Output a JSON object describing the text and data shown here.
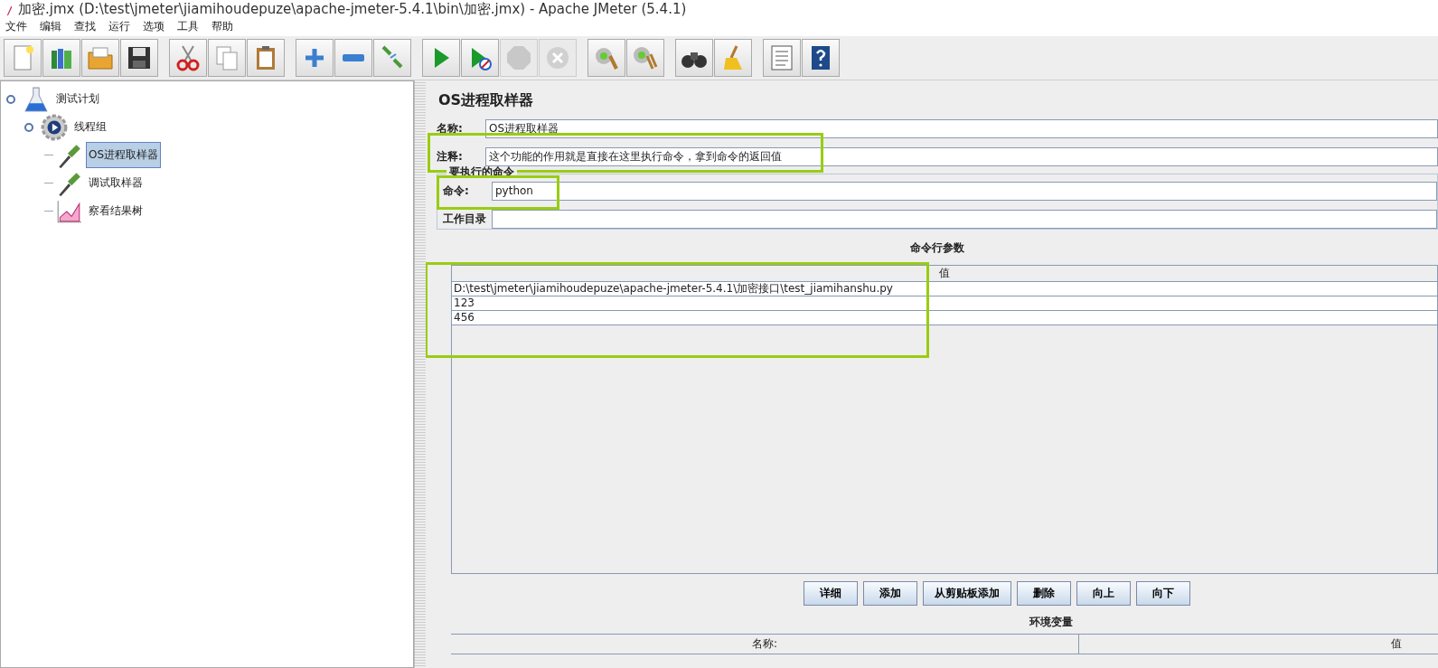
{
  "window": {
    "title": "加密.jmx (D:\\test\\jmeter\\jiamihoudepuze\\apache-jmeter-5.4.1\\bin\\加密.jmx) - Apache JMeter (5.4.1)"
  },
  "menu": [
    "文件",
    "编辑",
    "查找",
    "运行",
    "选项",
    "工具",
    "帮助"
  ],
  "toolbar": [
    [
      {
        "kind": "new",
        "disabled": false
      },
      {
        "kind": "templates",
        "disabled": false
      },
      {
        "kind": "open",
        "disabled": false
      },
      {
        "kind": "save",
        "disabled": false
      }
    ],
    [
      {
        "kind": "cut",
        "disabled": false
      },
      {
        "kind": "copy",
        "disabled": false
      },
      {
        "kind": "paste",
        "disabled": false
      }
    ],
    [
      {
        "kind": "expand",
        "disabled": false
      },
      {
        "kind": "collapse",
        "disabled": false
      },
      {
        "kind": "toggle",
        "disabled": false
      }
    ],
    [
      {
        "kind": "start",
        "disabled": false
      },
      {
        "kind": "start-no-pause",
        "disabled": false
      },
      {
        "kind": "stop",
        "disabled": true
      },
      {
        "kind": "shutdown",
        "disabled": true
      }
    ],
    [
      {
        "kind": "clear",
        "disabled": false
      },
      {
        "kind": "clear-all",
        "disabled": false
      }
    ],
    [
      {
        "kind": "search",
        "disabled": false
      },
      {
        "kind": "reset",
        "disabled": false
      }
    ],
    [
      {
        "kind": "functions",
        "disabled": false
      },
      {
        "kind": "help",
        "disabled": false
      }
    ]
  ],
  "tree": [
    {
      "label": "测试计划",
      "kind": "plan",
      "selected": false,
      "expanded": true,
      "children": [
        {
          "label": "线程组",
          "kind": "threads",
          "selected": false,
          "expanded": true,
          "children": [
            {
              "label": "OS进程取样器",
              "kind": "sampler",
              "selected": true
            },
            {
              "label": "调试取样器",
              "kind": "sampler",
              "selected": false
            },
            {
              "label": "察看结果树",
              "kind": "listener",
              "selected": false
            }
          ]
        }
      ]
    }
  ],
  "panel": {
    "title": "OS进程取样器",
    "name": {
      "label": "名称:",
      "value": "OS进程取样器",
      "highlighted": false
    },
    "comment": {
      "label": "注释:",
      "value": "这个功能的作用就是直接在这里执行命令，拿到命令的返回值",
      "highlighted": true
    },
    "command_group": {
      "legend": "要执行的命令",
      "command": {
        "label": "命令:",
        "value": "python",
        "highlighted": true
      },
      "working_dir": {
        "label": "工作目录"
      }
    },
    "arguments": {
      "title": "命令行参数",
      "columns": [
        "值"
      ],
      "rows": [
        "D:\\test\\jmeter\\jiamihoudepuze\\apache-jmeter-5.4.1\\加密接口\\test_jiamihanshu.py",
        "123",
        "456"
      ],
      "highlighted": true
    },
    "buttons": [
      "详细",
      "添加",
      "从剪贴板添加",
      "删除",
      "向上",
      "向下"
    ],
    "environment": {
      "title": "环境变量",
      "columns": [
        "名称:",
        "值"
      ]
    }
  }
}
